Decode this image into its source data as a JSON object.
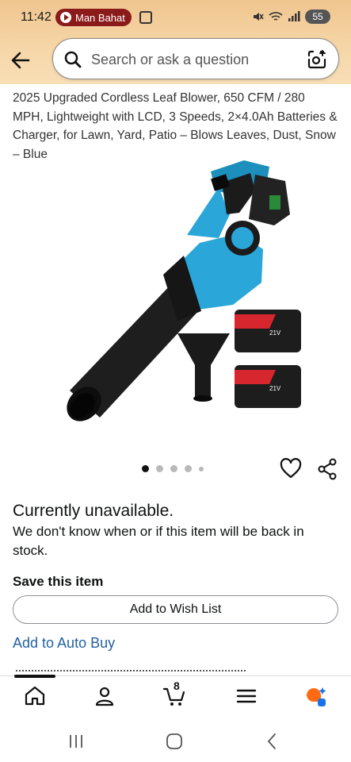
{
  "status": {
    "time": "11:42",
    "recording_label": "Man Bahat",
    "battery": "55"
  },
  "search": {
    "placeholder": "Search or ask a question"
  },
  "product": {
    "title": "2025 Upgraded Cordless Leaf Blower, 650 CFM / 280 MPH, Lightweight with LCD, 3 Speeds, 2×4.0Ah Batteries & Charger, for Lawn, Yard, Patio – Blows Leaves, Dust, Snow – Blue",
    "image_colors": {
      "body": "#2aa6d8",
      "dark": "#1b1b1b",
      "battery_red": "#d8262e"
    },
    "battery_label": "21V",
    "carousel": {
      "count": 5,
      "active_index": 0
    }
  },
  "availability": {
    "heading": "Currently unavailable.",
    "detail": "We don't know when or if this item will be back in stock."
  },
  "save": {
    "heading": "Save this item",
    "wishlist_button": "Add to Wish List",
    "autobuy_link": "Add to Auto Buy"
  },
  "nav": {
    "cart_count": "8",
    "items": [
      "home-icon",
      "account-icon",
      "cart-icon",
      "menu-icon",
      "rufus-icon"
    ]
  },
  "colors": {
    "header_gradient_top": "#f0c58f",
    "link": "#2162a1",
    "recording_pill": "#8b1a1a",
    "rufus_orange": "#ff6a13",
    "rufus_blue": "#1a73e8"
  }
}
